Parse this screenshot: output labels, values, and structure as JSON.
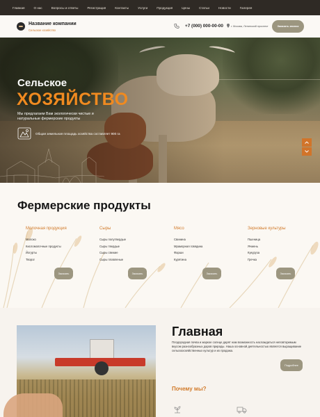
{
  "nav": {
    "items": [
      "Главная",
      "О нас",
      "Вопросы и ответы",
      "Регистрация",
      "Контакты",
      "Услуги",
      "Продукция",
      "Цены",
      "Статьи",
      "Новости",
      "Галерея"
    ]
  },
  "header": {
    "company_name": "Название компании",
    "company_sub": "Сельское хозяйство",
    "phone": "+7 (000) 000-00-00",
    "address": "г. Москва, Ленинский проспект",
    "order_call": "Заказать звонок"
  },
  "hero": {
    "title_line1": "Сельское",
    "title_line2": "ХОЗЯЙСТВО",
    "description": "Мы предлагаем Вам экологически чистые и натуральные фермерские продукты",
    "area_text": "Общая земельная площадь хозяйства составляет 900 га"
  },
  "products": {
    "title": "Фермерские продукты",
    "order_label": "Заказать",
    "categories": [
      {
        "title": "Молочная продукция",
        "items": [
          "Молоко",
          "Кисломолочные продукты",
          "Йогурты",
          "Творог"
        ]
      },
      {
        "title": "Сыры",
        "items": [
          "Сыры полутвердые",
          "Сыры твердые",
          "Сыры свежие",
          "Сыры плавленые"
        ]
      },
      {
        "title": "Мясо",
        "items": [
          "Свинина",
          "Мраморная говядина",
          "Фарши",
          "Курятина"
        ]
      },
      {
        "title": "Зерновые культуры",
        "items": [
          "Пшеница",
          "Ячмень",
          "Кукуруза",
          "Гречка"
        ]
      }
    ]
  },
  "main": {
    "title": "Главная",
    "text": "Плодородная почва и жаркое солнце дарят нам возможность наслаждаться неповторимым вкусом разнообразных даров природы. Наша основной деятельностью является выращивание сельскохозяйственных культур и их продажа.",
    "more_label": "Подробнее",
    "why_title": "Почему мы?"
  },
  "colors": {
    "accent": "#d17a2a",
    "button": "#9c9680",
    "nav_bg": "#2f2a25"
  }
}
